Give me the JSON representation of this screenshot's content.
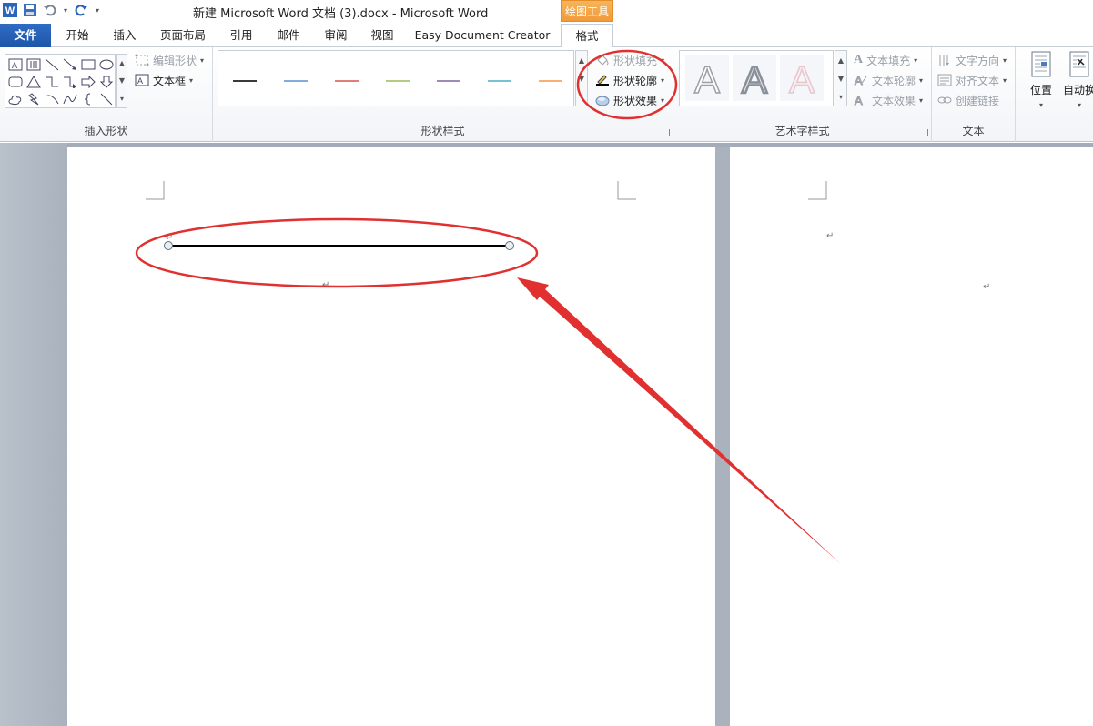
{
  "window": {
    "title": "新建 Microsoft Word 文档 (3).docx  -  Microsoft Word",
    "context_tab_header": "绘图工具"
  },
  "tabs": [
    {
      "label": "文件"
    },
    {
      "label": "开始"
    },
    {
      "label": "插入"
    },
    {
      "label": "页面布局"
    },
    {
      "label": "引用"
    },
    {
      "label": "邮件"
    },
    {
      "label": "审阅"
    },
    {
      "label": "视图"
    },
    {
      "label": "Easy Document Creator"
    },
    {
      "label": "格式"
    }
  ],
  "ribbon": {
    "insert_shapes": {
      "label": "插入形状",
      "edit_shape": "编辑形状",
      "text_box": "文本框"
    },
    "shape_styles": {
      "label": "形状样式",
      "fill": "形状填充",
      "outline": "形状轮廓",
      "effects": "形状效果",
      "line_colors": [
        "#3a3a3a",
        "#5b8fcf",
        "#d9534f",
        "#9bbb59",
        "#8064a2",
        "#4bacc6",
        "#f79646"
      ]
    },
    "wordart_styles": {
      "label": "艺术字样式",
      "text_fill": "文本填充",
      "text_outline": "文本轮廓",
      "text_effects": "文本效果"
    },
    "text_group": {
      "label": "文本",
      "text_direction": "文字方向",
      "align_text": "对齐文本",
      "create_link": "创建链接"
    },
    "arrange": {
      "position": "位置",
      "wrap_text": "自动换"
    }
  },
  "colors": {
    "accent_blue": "#2b64b8",
    "context_orange": "#f4a84a",
    "annotation_red": "#e03030"
  }
}
